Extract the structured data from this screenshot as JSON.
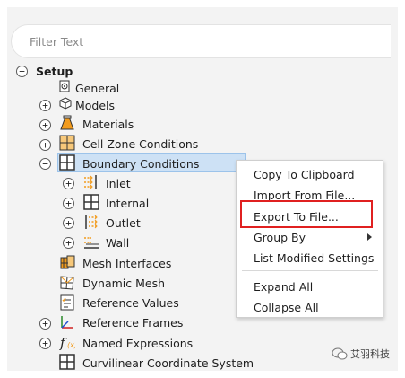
{
  "filter": {
    "placeholder": "Filter Text"
  },
  "tree": {
    "setup": "Setup",
    "general": "General",
    "models": "Models",
    "materials": "Materials",
    "cell_zone": "Cell Zone Conditions",
    "boundary": "Boundary Conditions",
    "inlet": "Inlet",
    "internal": "Internal",
    "outlet": "Outlet",
    "wall": "Wall",
    "mesh_interfaces": "Mesh Interfaces",
    "dynamic_mesh": "Dynamic Mesh",
    "reference_values": "Reference Values",
    "reference_frames": "Reference Frames",
    "named_expressions": "Named Expressions",
    "curvilinear": "Curvilinear Coordinate System"
  },
  "context_menu": {
    "copy": "Copy To Clipboard",
    "import": "Import From File...",
    "export": "Export To File...",
    "group_by": "Group By",
    "list_modified": "List Modified Settings",
    "expand_all": "Expand All",
    "collapse_all": "Collapse All"
  },
  "watermark": {
    "text": "艾羽科技"
  },
  "colors": {
    "selection": "#cde1f5",
    "highlight_box": "#e02020",
    "icon_orange": "#f29b1d"
  }
}
